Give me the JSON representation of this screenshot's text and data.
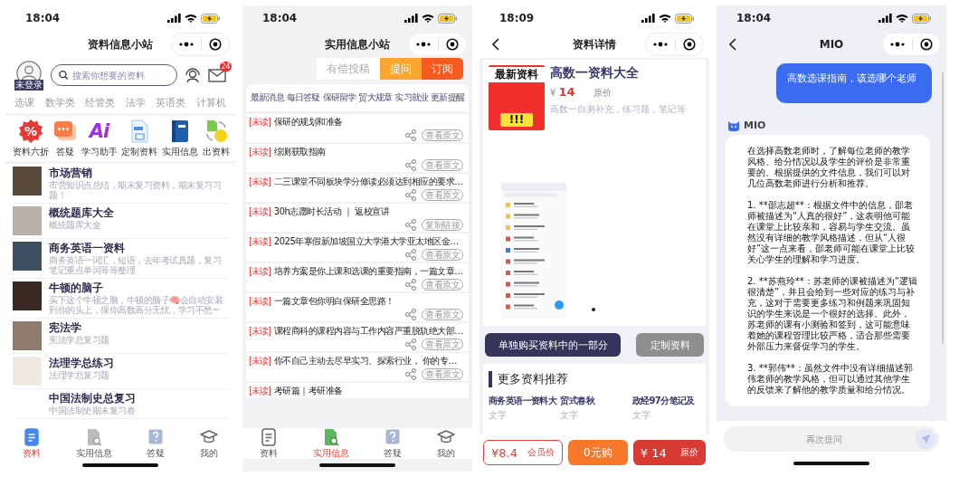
{
  "home_screen": {
    "status_bar": {
      "time": "18:04"
    },
    "title": "资料信息小站",
    "avatar_badge": "未登录",
    "search": {
      "placeholder": "搜索你想要的资料"
    },
    "mail_badge": "24",
    "categories": [
      "选课",
      "数学类",
      "经管类",
      "法学",
      "英语类",
      "计算机"
    ],
    "shortcuts": [
      {
        "label": "资料六折",
        "kind": "discount",
        "icon_text": "%"
      },
      {
        "label": "答疑",
        "kind": "chat"
      },
      {
        "label": "学习助手",
        "kind": "ai",
        "icon_text": "Ai"
      },
      {
        "label": "定制资料",
        "kind": "file"
      },
      {
        "label": "实用信息",
        "kind": "book"
      },
      {
        "label": "出资料",
        "kind": "exchange"
      }
    ],
    "items": [
      {
        "title": "市场营销",
        "description": "市营知识点总结，期末复习资料，期末复习习题！",
        "image": true
      },
      {
        "title": "概统题库大全",
        "description": "概统题库大全",
        "image": true
      },
      {
        "title": "商务英语一资料",
        "description": "商务英语一词汇，短语，去年考试真题，复习笔记重点单词等等整理",
        "image": true
      },
      {
        "title": "牛顿的脑子",
        "description": "买下这个牛顿之脑，牛顿的脑子🧠会自动安装到你的头上，保你高数高分无忧，学习不愁~",
        "image": true
      },
      {
        "title": "宪法学",
        "description": "宪法学总复习题",
        "image": true
      },
      {
        "title": "法理学总练习",
        "description": "法理学总复习题",
        "image": true
      },
      {
        "title": "中国法制史总复习",
        "description": "中国法制史期末复习卷",
        "image": false
      }
    ],
    "tab_bar": [
      {
        "label": "资料",
        "kind": "doc",
        "selected": true
      },
      {
        "label": "实用信息",
        "kind": "info",
        "selected": false
      },
      {
        "label": "答疑",
        "kind": "qa",
        "selected": false
      },
      {
        "label": "我的",
        "kind": "profile",
        "selected": false
      }
    ]
  },
  "info_screen": {
    "status_bar": {
      "time": "18:04"
    },
    "title": "实用信息小站",
    "header_buttons": [
      {
        "label": "有偿投稿",
        "kind": "plain"
      },
      {
        "label": "提问",
        "kind": "ask"
      },
      {
        "label": "订阅",
        "kind": "subscribe"
      }
    ],
    "categories": [
      "最新消息",
      "每日答疑",
      "保研留学",
      "贸大规章",
      "实习就业",
      "更新提醒"
    ],
    "articles": [
      {
        "tag": "[未读]",
        "title": "保研的规划和准备",
        "action": "查看原文"
      },
      {
        "tag": "[未读]",
        "title": "综测获取指南",
        "action": "查看原文"
      },
      {
        "tag": "[未读]",
        "title": "二三课堂不同板块学分修读必须达到相应的要求…",
        "action": "查看原文"
      },
      {
        "tag": "[未读]",
        "title": "30h志愿时长活动 ｜ 返校宣讲",
        "action": "复制链接"
      },
      {
        "tag": "[未读]",
        "title": "2025年寒假新加坡国立大学港大学亚太地区金…",
        "action": "查看原文"
      },
      {
        "tag": "[未读]",
        "title": "培养方案是你上课和选课的重要指南，一篇文章…",
        "action": "查看原文"
      },
      {
        "tag": "[未读]",
        "title": "一篇文章包你明白保研全思路！",
        "action": "查看原文"
      },
      {
        "tag": "[未读]",
        "title": "课程商科的课程内容与工作内容严重脱轨绝大部…",
        "action": "查看原文"
      },
      {
        "tag": "[未读]",
        "title": "你不自己主动去尽早实习、探索行业， 你的专…",
        "action": "查看原文"
      },
      {
        "tag": "[未读]",
        "title": "考研篇｜考研准备"
      }
    ],
    "tab_bar": [
      {
        "label": "资料",
        "kind": "doc",
        "selected": false
      },
      {
        "label": "实用信息",
        "kind": "info",
        "selected": true
      },
      {
        "label": "答疑",
        "kind": "qa",
        "selected": false
      },
      {
        "label": "我的",
        "kind": "profile",
        "selected": false
      }
    ]
  },
  "detail_screen": {
    "status_bar": {
      "time": "18:09"
    },
    "title": "资料详情",
    "cover": {
      "headline": "最新资料",
      "marks": "!!!"
    },
    "name": "高数一资料大全",
    "currency": "¥",
    "price": "14",
    "price_label": "原价",
    "description": "高数一自测补充，练习题，笔记等",
    "buttons": [
      {
        "label": "单独购买资料中的一部分",
        "kind": "primary"
      },
      {
        "label": "定制资料",
        "kind": "secondary"
      }
    ],
    "section_title": "更多资料推荐",
    "recommendations": [
      {
        "title": "商务英语一资料大",
        "type": "文字"
      },
      {
        "title": "贸式春秋",
        "type": "文字"
      },
      {
        "title": "政经97分笔记及",
        "type": "文字"
      }
    ],
    "bottom_bar": [
      {
        "kind": "member",
        "price": "¥8.4",
        "label": "会员价"
      },
      {
        "kind": "free",
        "label": "0元购"
      },
      {
        "kind": "original",
        "price": "¥ 14",
        "label": "原价"
      }
    ]
  },
  "chat_screen": {
    "status_bar": {
      "time": "18:04"
    },
    "title": "MIO",
    "user_message": "高数选课指南，该选哪个老师",
    "bot_name": "MIO",
    "bot_paragraphs": [
      "在选择高数老师时，了解每位老师的教学风格、给分情况以及学生的评价是非常重要的。根据提供的文件信息，我们可以对几位高数老师进行分析和推荐。",
      "1. **邵志超**：根据文件中的信息，邵老师被描述为“人真的很好”，这表明他可能在课堂上比较亲和，容易与学生交流。虽然没有详细的教学风格描述，但从“人很好”这一点来看，邵老师可能在课堂上比较关心学生的理解和学习进度。",
      "2. **苏燕玲**：苏老师的课被描述为“逻辑很清楚”，并且会给到一些对应的练习与补充，这对于需要更多练习和例题来巩固知识的学生来说是一个很好的选择。此外，苏老师的课有小测验和签到，这可能意味着她的课程管理比较严格，适合那些需要外部压力来督促学习的学生。",
      "3. **郭伟**：虽然文件中没有详细描述郭伟老师的教学风格，但可以通过其他学生的反馈来了解他的教学质量和给分情况。"
    ],
    "input": {
      "placeholder": "再次提问"
    }
  }
}
